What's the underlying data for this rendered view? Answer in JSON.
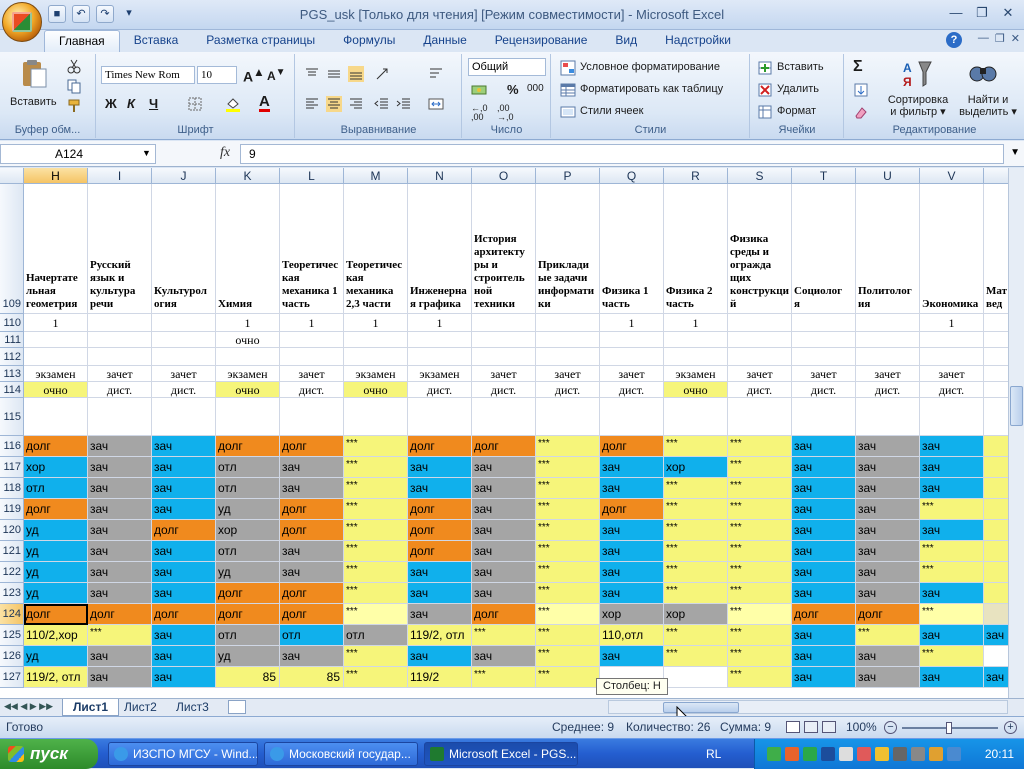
{
  "window": {
    "title": "PGS_usk  [Только для чтения]  [Режим совместимости] - Microsoft Excel"
  },
  "tabs": [
    "Главная",
    "Вставка",
    "Разметка страницы",
    "Формулы",
    "Данные",
    "Рецензирование",
    "Вид",
    "Надстройки"
  ],
  "ribbon": {
    "clipboard": {
      "label": "Буфер обм...",
      "paste": "Вставить"
    },
    "font": {
      "label": "Шрифт",
      "family": "Times New Rom",
      "size": "10",
      "bold": "Ж",
      "italic": "К",
      "underline": "Ч",
      "font_color": "A"
    },
    "alignment": {
      "label": "Выравнивание"
    },
    "number": {
      "label": "Число",
      "format": "Общий",
      "percent": "%",
      "thousands": "000"
    },
    "styles": {
      "label": "Стили",
      "conditional": "Условное форматирование",
      "as_table": "Форматировать как таблицу",
      "cell_styles": "Стили ячеек"
    },
    "cells": {
      "label": "Ячейки",
      "insert": "Вставить",
      "delete": "Удалить",
      "format": "Формат"
    },
    "editing": {
      "label": "Редактирование",
      "sigma": "Σ",
      "sort": "Сортировка\nи фильтр",
      "find": "Найти и\nвыделить"
    }
  },
  "formula_bar": {
    "name_box": "A124",
    "fx": "fx",
    "value": "9"
  },
  "columns": [
    "H",
    "I",
    "J",
    "K",
    "L",
    "M",
    "N",
    "O",
    "P",
    "Q",
    "R",
    "S",
    "T",
    "U",
    "V",
    ""
  ],
  "selected_column": "",
  "header_row": {
    "row": "109",
    "cells": [
      "Начертательная геометрия",
      "Русский язык и культура речи",
      "Культурология",
      "Химия",
      "Теоретическая механика 1 часть",
      "Теоретическая механика 2,3 части",
      "Инженерная графика",
      "История архитектуры и строительной техники",
      "Прикладные задачи информатики",
      "Физика 1 часть",
      "Физика 2 часть",
      "Физика среды и ограждающих конструкций",
      "Социология",
      "Политология",
      "Экономика",
      "Мате ведо"
    ]
  },
  "header_cells_display": [
    "Начертате\nльная\nгеометрия",
    "Русский\nязык и\nкультура\nречи",
    "Культурол\nогия",
    "Химия",
    "Теоретичес\nкая\nмеханика 1\nчасть",
    "Теоретичес\nкая\nмеханика\n2,3 части",
    "Инженерна\nя графика",
    "История\nархитекту\nры и\nстроитель\nной\nтехники",
    "Приклади\nые задачи\nинформати\nки",
    "Физика 1\nчасть",
    "Физика 2\nчасть",
    "Физика\nсреды и\nогражда\nщих\nконструкци\nй",
    "Социолог\nя",
    "Политолог\nия",
    "Экономика",
    "Мат\nвед"
  ],
  "rows": [
    {
      "n": "110",
      "cells": [
        "1",
        "",
        "",
        "1",
        "1",
        "1",
        "1",
        "",
        "",
        "1",
        "1",
        "",
        "",
        "",
        "1",
        ""
      ]
    },
    {
      "n": "111",
      "cells": [
        "",
        "",
        "",
        "очно",
        "",
        "",
        "",
        "",
        "",
        "",
        "",
        "",
        "",
        "",
        "",
        ""
      ]
    },
    {
      "n": "112",
      "cells": [
        "",
        "",
        "",
        "",
        "",
        "",
        "",
        "",
        "",
        "",
        "",
        "",
        "",
        "",
        "",
        ""
      ]
    },
    {
      "n": "113",
      "cells": [
        "экзамен",
        "зачет",
        "зачет",
        "экзамен",
        "зачет",
        "экзамен",
        "экзамен",
        "зачет",
        "зачет",
        "зачет",
        "экзамен",
        "зачет",
        "зачет",
        "зачет",
        "зачет",
        "з"
      ]
    },
    {
      "n": "114",
      "cells": [
        "очно",
        "дист.",
        "дист.",
        "очно",
        "дист.",
        "очно",
        "дист.",
        "дист.",
        "дист.",
        "дист.",
        "очно",
        "дист.",
        "дист.",
        "дист.",
        "дист.",
        "д"
      ]
    },
    {
      "n": "115",
      "cells": [
        "",
        "",
        "",
        "",
        "",
        "",
        "",
        "",
        "",
        "",
        "",
        "",
        "",
        "",
        "",
        ""
      ]
    },
    {
      "n": "116",
      "cells": [
        "долг",
        "зач",
        "зач",
        "долг",
        "долг",
        "***",
        "долг",
        "долг",
        "***",
        "долг",
        "***",
        "***",
        "зач",
        "зач",
        "зач",
        ""
      ]
    },
    {
      "n": "117",
      "cells": [
        "хор",
        "зач",
        "зач",
        "отл",
        "зач",
        "***",
        "зач",
        "зач",
        "***",
        "зач",
        "хор",
        "***",
        "зач",
        "зач",
        "зач",
        ""
      ]
    },
    {
      "n": "118",
      "cells": [
        "отл",
        "зач",
        "зач",
        "отл",
        "зач",
        "***",
        "зач",
        "зач",
        "***",
        "зач",
        "***",
        "***",
        "зач",
        "зач",
        "зач",
        ""
      ]
    },
    {
      "n": "119",
      "cells": [
        "долг",
        "зач",
        "зач",
        "уд",
        "долг",
        "***",
        "долг",
        "зач",
        "***",
        "долг",
        "***",
        "***",
        "зач",
        "зач",
        "***",
        ""
      ]
    },
    {
      "n": "120",
      "cells": [
        "уд",
        "зач",
        "долг",
        "хор",
        "долг",
        "***",
        "долг",
        "зач",
        "***",
        "зач",
        "***",
        "***",
        "зач",
        "зач",
        "зач",
        ""
      ]
    },
    {
      "n": "121",
      "cells": [
        "уд",
        "зач",
        "зач",
        "отл",
        "зач",
        "***",
        "долг",
        "зач",
        "***",
        "зач",
        "***",
        "***",
        "зач",
        "зач",
        "***",
        ""
      ]
    },
    {
      "n": "122",
      "cells": [
        "уд",
        "зач",
        "зач",
        "уд",
        "зач",
        "***",
        "зач",
        "зач",
        "***",
        "зач",
        "***",
        "***",
        "зач",
        "зач",
        "***",
        ""
      ]
    },
    {
      "n": "123",
      "cells": [
        "уд",
        "зач",
        "зач",
        "долг",
        "долг",
        "***",
        "зач",
        "зач",
        "***",
        "зач",
        "***",
        "***",
        "зач",
        "зач",
        "зач",
        ""
      ]
    },
    {
      "n": "124",
      "cells": [
        "долг",
        "долг",
        "долг",
        "долг",
        "долг",
        "***",
        "зач",
        "долг",
        "***",
        "хор",
        "хор",
        "***",
        "долг",
        "долг",
        "***",
        ""
      ]
    },
    {
      "n": "125",
      "cells": [
        "110/2,хор",
        "***",
        "зач",
        "отл",
        "отл",
        "отл",
        "119/2, отл",
        "***",
        "***",
        "110,отл",
        "***",
        "***",
        "зач",
        "***",
        "зач",
        "зач"
      ]
    },
    {
      "n": "126",
      "cells": [
        "уд",
        "зач",
        "зач",
        "уд",
        "зач",
        "***",
        "зач",
        "зач",
        "***",
        "зач",
        "***",
        "***",
        "зач",
        "зач",
        "***",
        ""
      ]
    },
    {
      "n": "127",
      "cells": [
        "119/2, отл",
        "зач",
        "зач",
        "85",
        "85",
        "***",
        "119/2",
        "***",
        "***",
        "",
        "",
        "***",
        "зач",
        "зач",
        "зач",
        "зач"
      ]
    }
  ],
  "colors": {
    "orange": "#f08a1e",
    "blue": "#10b0ec",
    "gray": "#a5a5a5",
    "yellow": "#f6f57a",
    "light_yellow": "#ffffa8",
    "selected_row": "#e8e3c0"
  },
  "sheet_tabs": [
    "Лист1",
    "Лист2",
    "Лист3"
  ],
  "tooltip": "Столбец: H",
  "status": {
    "ready": "Готово",
    "average": "Среднее: 9",
    "count": "Количество: 26",
    "sum": "Сумма: 9",
    "zoom": "100%"
  },
  "taskbar": {
    "start": "пуск",
    "tasks": [
      "ИЗСПО МГСУ - Wind...",
      "Московский государ...",
      "Microsoft Excel - PGS..."
    ],
    "lang": "RL",
    "clock": "20:11"
  }
}
